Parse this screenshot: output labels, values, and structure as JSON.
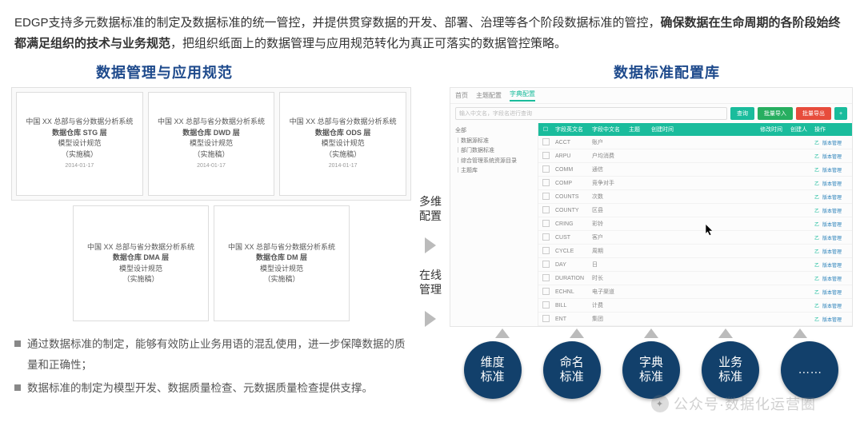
{
  "top": {
    "pre": "EDGP支持多元数据标准的制定及数据标准的统一管控，并提供贯穿数据的开发、部署、治理等各个阶段数据标准的管控，",
    "bold": "确保数据在生命周期的各阶段始终都满足组织的技术与业务规范",
    "post": "，把组织纸面上的数据管理与应用规范转化为真正可落实的数据管控策略。"
  },
  "titles": {
    "left": "数据管理与应用规范",
    "right": "数据标准配置库"
  },
  "docs": {
    "row1": [
      {
        "l1": "中国 XX 总部与省分数据分析系统",
        "l2": "数据仓库 STG 层",
        "l3": "模型设计规范",
        "l4": "（实施稿）",
        "date": "2014-01-17"
      },
      {
        "l1": "中国 XX 总部与省分数据分析系统",
        "l2": "数据仓库 DWD 层",
        "l3": "模型设计规范",
        "l4": "（实施稿）",
        "date": "2014-01-17"
      },
      {
        "l1": "中国 XX 总部与省分数据分析系统",
        "l2": "数据仓库 ODS 层",
        "l3": "模型设计规范",
        "l4": "（实施稿）",
        "date": "2014-01-17"
      }
    ],
    "row2": [
      {
        "l1": "中国 XX 总部与省分数据分析系统",
        "l2": "数据仓库 DMA 层",
        "l3": "模型设计规范",
        "l4": "（实施稿）",
        "date": ""
      },
      {
        "l1": "中国 XX 总部与省分数据分析系统",
        "l2": "数据仓库 DM 层",
        "l3": "模型设计规范",
        "l4": "（实施稿）",
        "date": ""
      }
    ]
  },
  "bullets": [
    "通过数据标准的制定，能够有效防止业务用语的混乱使用，进一步保障数据的质量和正确性；",
    "数据标准的制定为模型开发、数据质量检查、元数据质量检查提供支撑。"
  ],
  "mid": {
    "a": "多维\n配置",
    "b": "在线\n管理"
  },
  "app": {
    "tabs": [
      "首页",
      "主题配置",
      "字典配置"
    ],
    "search_ph": "输入中文名，字段名进行查询",
    "btns": {
      "query": "查询",
      "impA": "批量导入",
      "expA": "批量导出",
      "plus": "+"
    },
    "tree": [
      "全部",
      "｜数据源标准",
      "｜部门数据标准",
      "｜综合管理系统资源目录",
      "｜主题库"
    ],
    "head": {
      "cb": "",
      "en": "字段英文名",
      "cn": "字段中文名",
      "t": "主题",
      "d": "创建时间",
      "m": "修改时间",
      "p": "创建人",
      "op": "操作"
    },
    "rows": [
      {
        "en": "ACCT",
        "cn": "账户"
      },
      {
        "en": "ARPU",
        "cn": "户均消费"
      },
      {
        "en": "COMM",
        "cn": "通信"
      },
      {
        "en": "COMP",
        "cn": "竞争对手"
      },
      {
        "en": "COUNTS",
        "cn": "次数"
      },
      {
        "en": "COUNTY",
        "cn": "区县"
      },
      {
        "en": "CRING",
        "cn": "彩铃"
      },
      {
        "en": "CUST",
        "cn": "客户"
      },
      {
        "en": "CYCLE",
        "cn": "周期"
      },
      {
        "en": "DAY",
        "cn": "日"
      },
      {
        "en": "DURATION",
        "cn": "时长"
      },
      {
        "en": "ECHNL",
        "cn": "电子渠道"
      },
      {
        "en": "BILL",
        "cn": "计费"
      },
      {
        "en": "ENT",
        "cn": "集团"
      }
    ],
    "op": {
      "edit": "乙",
      "link": "版本管理"
    }
  },
  "circles": [
    "维度\n标准",
    "命名\n标准",
    "字典\n标准",
    "业务\n标准",
    "……"
  ],
  "watermark": "公众号·数据化运营圈"
}
